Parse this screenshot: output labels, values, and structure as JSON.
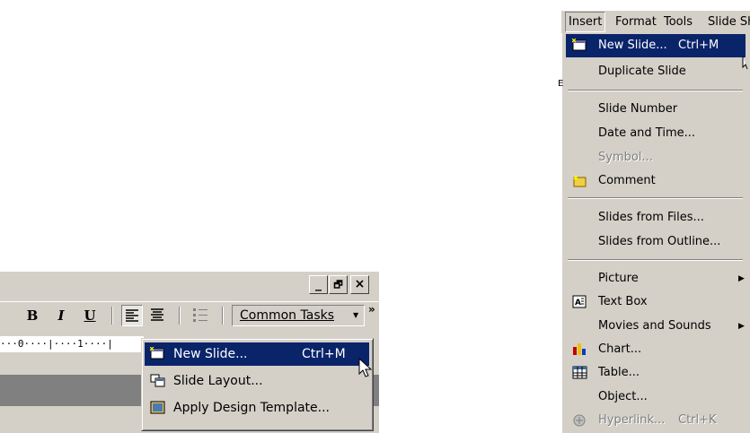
{
  "window": {
    "minimize_label": "_",
    "restore_label": "🗗",
    "close_label": "×"
  },
  "toolbar": {
    "bold_label": "B",
    "italic_label": "I",
    "underline_label": "U",
    "common_tasks_label": "Common Tasks",
    "more_label": "»"
  },
  "ruler": {
    "text": "···0····|····1····|"
  },
  "common_tasks_menu": {
    "items": [
      {
        "label": "New Slide...",
        "shortcut": "Ctrl+M",
        "icon": "new-slide-icon",
        "highlighted": true
      },
      {
        "label": "Slide Layout...",
        "shortcut": "",
        "icon": "slide-layout-icon"
      },
      {
        "label": "Apply Design Template...",
        "shortcut": "",
        "icon": "design-template-icon"
      }
    ]
  },
  "menubar": {
    "items": [
      "Insert",
      "Format",
      "Tools",
      "Slide Show"
    ]
  },
  "insert_menu": {
    "items": [
      {
        "label": "New Slide...",
        "shortcut": "Ctrl+M",
        "icon": "new-slide-icon",
        "highlighted": true
      },
      {
        "label": "Duplicate Slide"
      },
      {
        "label": "Slide Number"
      },
      {
        "label": "Date and Time..."
      },
      {
        "label": "Symbol...",
        "disabled": true
      },
      {
        "label": "Comment",
        "icon": "comment-icon"
      },
      {
        "label": "Slides from Files..."
      },
      {
        "label": "Slides from Outline..."
      },
      {
        "label": "Picture",
        "submenu": true
      },
      {
        "label": "Text Box",
        "icon": "text-box-icon"
      },
      {
        "label": "Movies and Sounds",
        "submenu": true
      },
      {
        "label": "Chart...",
        "icon": "chart-icon"
      },
      {
        "label": "Table...",
        "icon": "table-icon"
      },
      {
        "label": "Object..."
      },
      {
        "label": "Hyperlink...",
        "shortcut": "Ctrl+K",
        "icon": "hyperlink-icon",
        "disabled": true
      }
    ]
  },
  "stray_text": "E"
}
